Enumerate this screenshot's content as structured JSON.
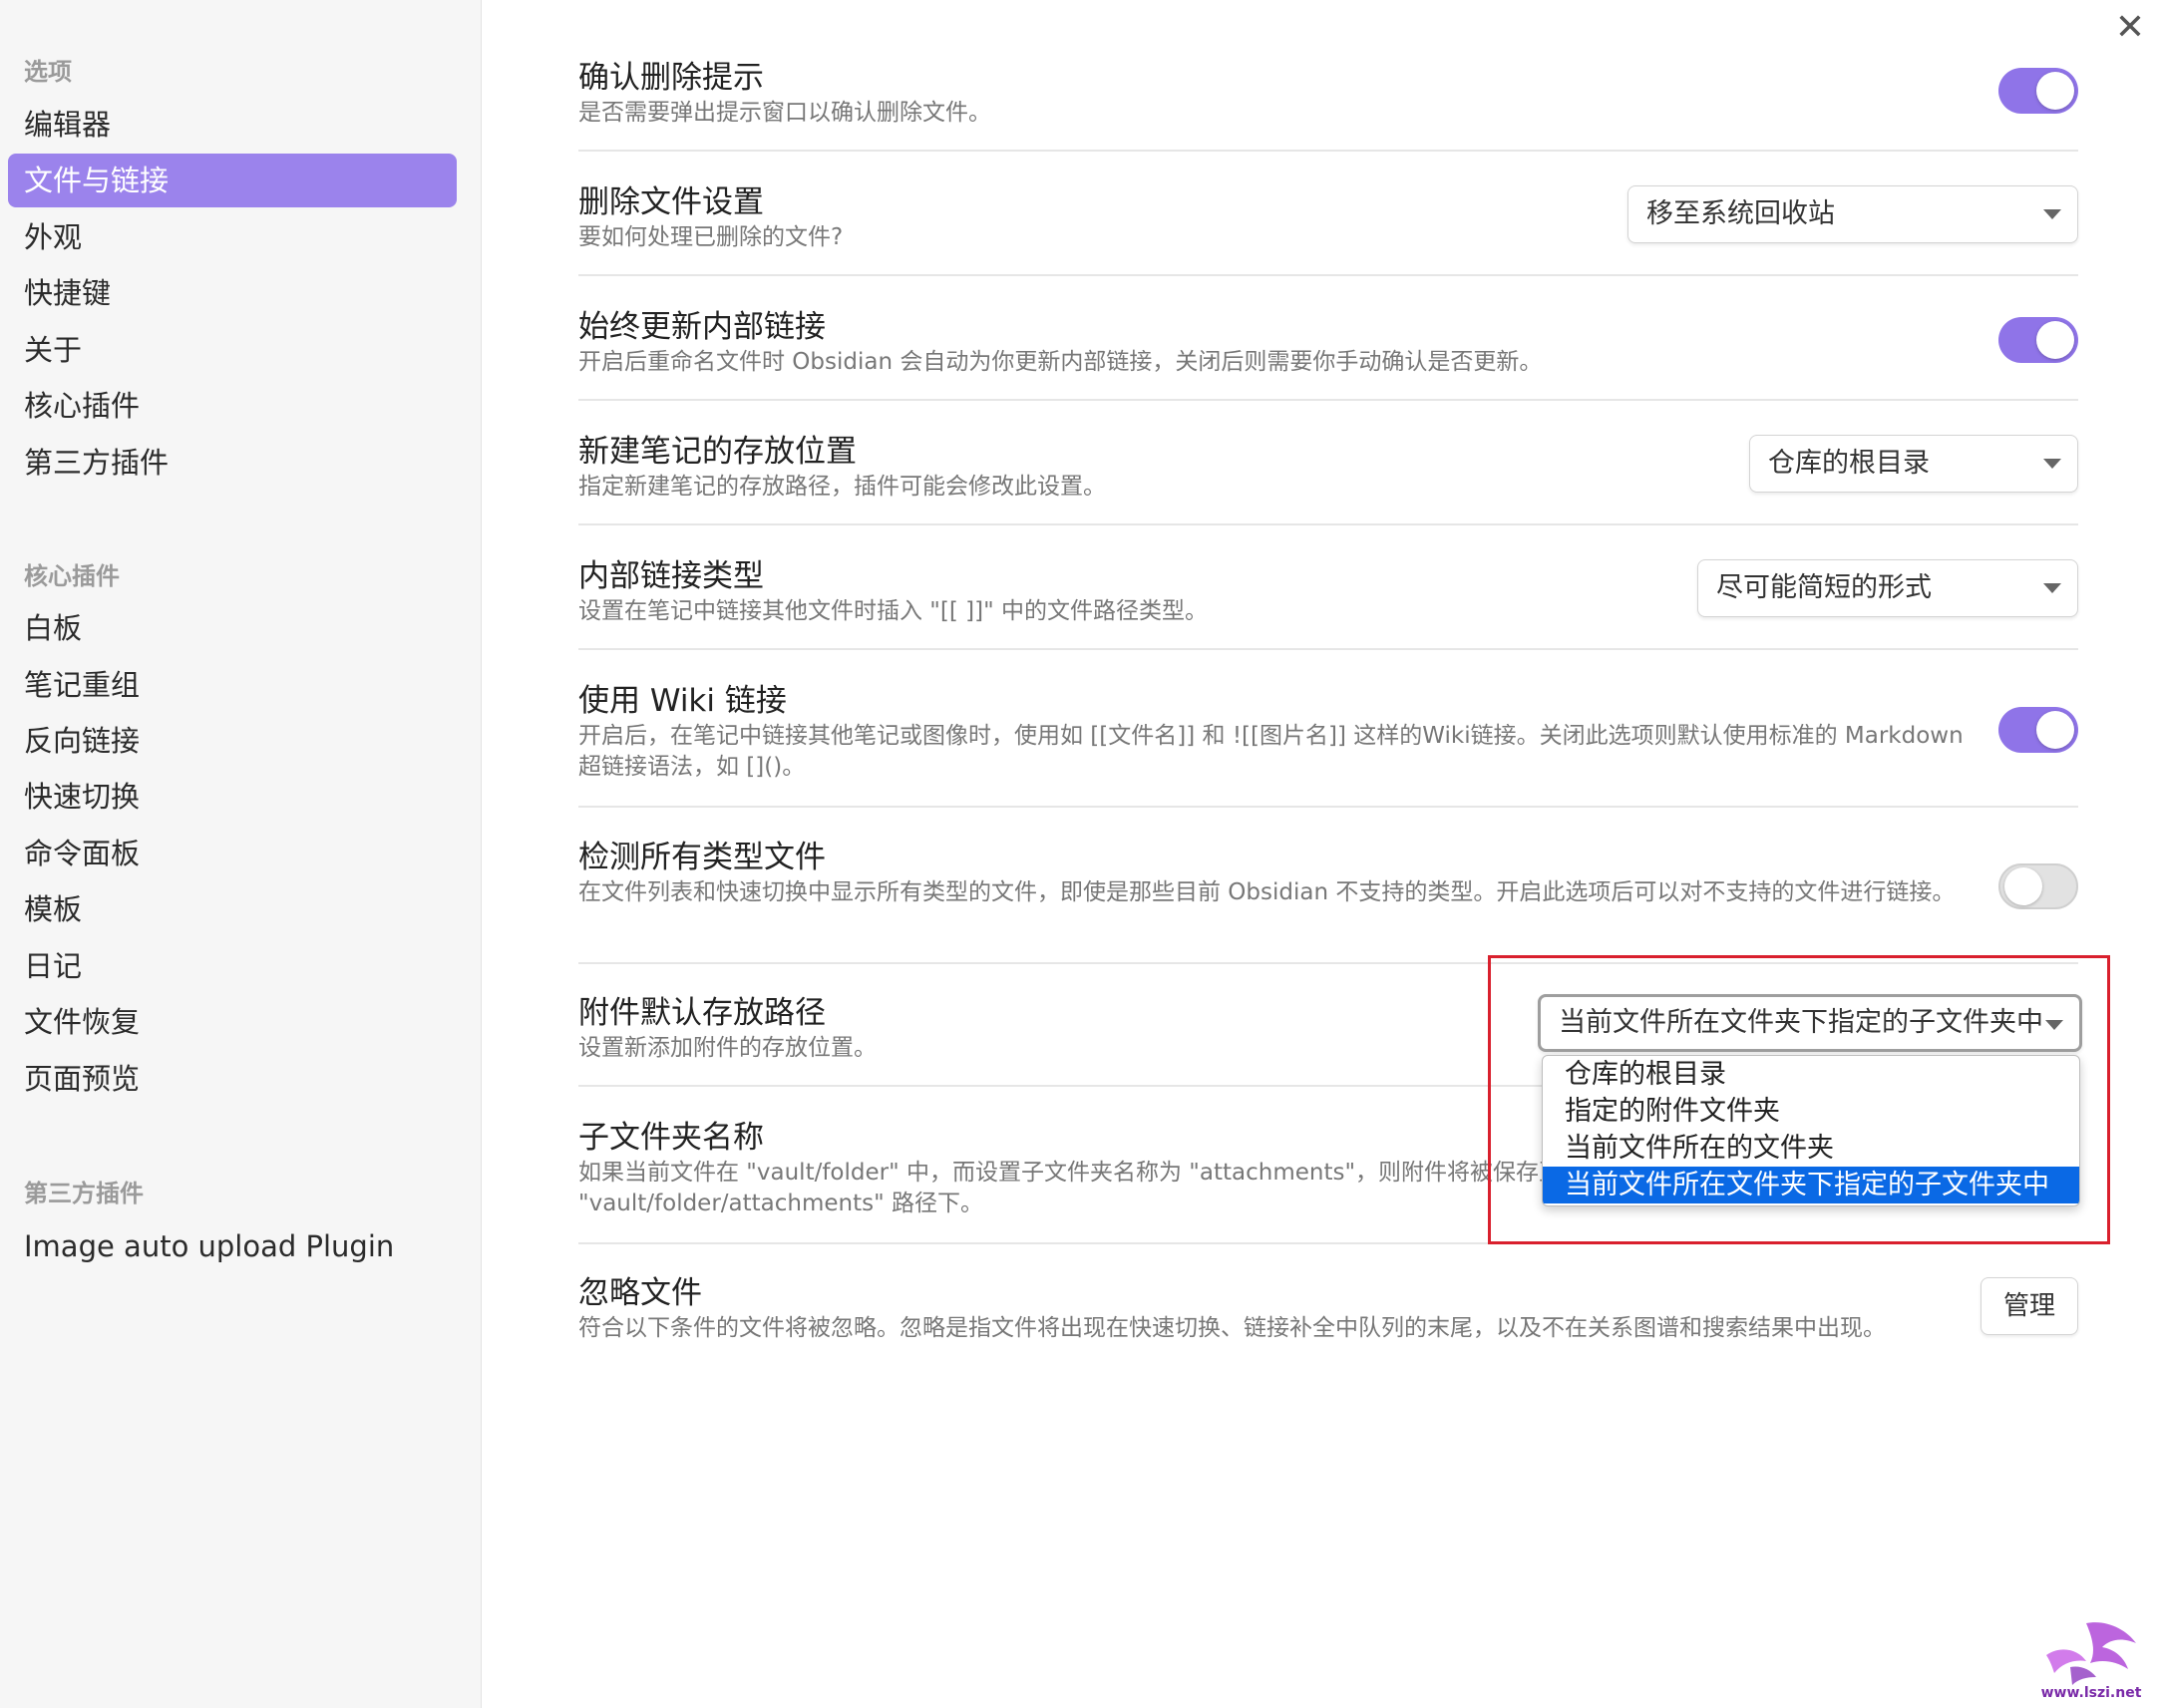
{
  "sidebar": {
    "section_options": "选项",
    "options_items": [
      "编辑器",
      "文件与链接",
      "外观",
      "快捷键",
      "关于",
      "核心插件",
      "第三方插件"
    ],
    "active_item": "文件与链接",
    "section_core": "核心插件",
    "core_items": [
      "白板",
      "笔记重组",
      "反向链接",
      "快速切换",
      "命令面板",
      "模板",
      "日记",
      "文件恢复",
      "页面预览"
    ],
    "section_third": "第三方插件",
    "third_items": [
      "Image auto upload Plugin"
    ]
  },
  "settings": {
    "confirm_delete": {
      "title": "确认删除提示",
      "desc": "是否需要弹出提示窗口以确认删除文件。",
      "enabled": true
    },
    "delete_files": {
      "title": "删除文件设置",
      "desc": "要如何处理已删除的文件?",
      "value": "移至系统回收站"
    },
    "update_links": {
      "title": "始终更新内部链接",
      "desc": "开启后重命名文件时 Obsidian 会自动为你更新内部链接，关闭后则需要你手动确认是否更新。",
      "enabled": true
    },
    "new_note_location": {
      "title": "新建笔记的存放位置",
      "desc": "指定新建笔记的存放路径，插件可能会修改此设置。",
      "value": "仓库的根目录"
    },
    "link_format": {
      "title": "内部链接类型",
      "desc": "设置在笔记中链接其他文件时插入 \"[[ ]]\" 中的文件路径类型。",
      "value": "尽可能简短的形式"
    },
    "wiki_links": {
      "title": "使用 Wiki 链接",
      "desc": "开启后，在笔记中链接其他笔记或图像时，使用如 [[文件名]] 和 ![[图片名]] 这样的Wiki链接。关闭此选项则默认使用标准的 Markdown 超链接语法，如 []()。",
      "enabled": true
    },
    "detect_all_types": {
      "title": "检测所有类型文件",
      "desc": "在文件列表和快速切换中显示所有类型的文件，即使是那些目前 Obsidian 不支持的类型。开启此选项后可以对不支持的文件进行链接。",
      "enabled": false
    },
    "attachment_location": {
      "title": "附件默认存放路径",
      "desc": "设置新添加附件的存放位置。",
      "value": "当前文件所在文件夹下指定的子文件夹中",
      "options": [
        "仓库的根目录",
        "指定的附件文件夹",
        "当前文件所在的文件夹",
        "当前文件所在文件夹下指定的子文件夹中"
      ],
      "selected_index": 3
    },
    "subfolder_name": {
      "title": "子文件夹名称",
      "desc": "如果当前文件在 \"vault/folder\" 中，而设置子文件夹名称为 \"attachments\"，则附件将被保存至 \"vault/folder/attachments\" 路径下。"
    },
    "ignore_files": {
      "title": "忽略文件",
      "desc": "符合以下条件的文件将被忽略。忽略是指文件将出现在快速切换、链接补全中队列的末尾，以及不在关系图谱和搜索结果中出现。",
      "button": "管理"
    }
  },
  "icons": {
    "close": "close-icon"
  },
  "colors": {
    "accent": "#8f74e8",
    "sidebar_active": "#9b83ec",
    "dropdown_selected": "#0a69e5",
    "highlight_box": "#d9202d"
  },
  "watermark": {
    "text": "www.lszi.net"
  }
}
